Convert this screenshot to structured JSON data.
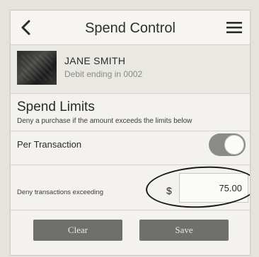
{
  "header": {
    "title": "Spend Control",
    "back_icon": "chevron-left-icon",
    "menu_icon": "hamburger-menu-icon"
  },
  "account": {
    "name": "JANE SMITH",
    "subtitle": "Debit ending in 0002"
  },
  "spend_limits": {
    "title": "Spend Limits",
    "description": "Deny a purchase if the amount exceeds the limits below",
    "per_transaction": {
      "label": "Per Transaction",
      "enabled": true
    },
    "deny_row": {
      "label": "Deny transactions exceeding",
      "currency": "$",
      "amount": "75.00"
    }
  },
  "actions": {
    "clear_label": "Clear",
    "save_label": "Save"
  },
  "colors": {
    "button_bg": "#6f6f6c",
    "toggle_on": "#8a8a86",
    "page_bg": "#f3f2ee"
  }
}
